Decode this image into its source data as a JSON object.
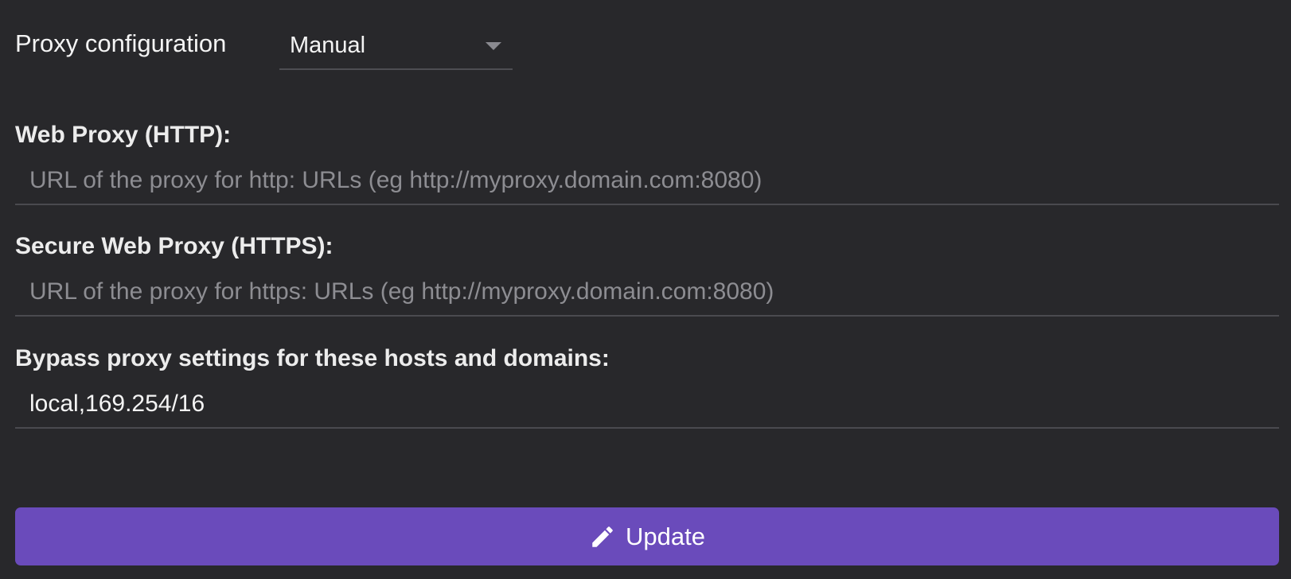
{
  "proxy_config": {
    "label": "Proxy configuration",
    "selected": "Manual"
  },
  "http_proxy": {
    "label": "Web Proxy (HTTP):",
    "value": "",
    "placeholder": "URL of the proxy for http: URLs (eg http://myproxy.domain.com:8080)"
  },
  "https_proxy": {
    "label": "Secure Web Proxy (HTTPS):",
    "value": "",
    "placeholder": "URL of the proxy for https: URLs (eg http://myproxy.domain.com:8080)"
  },
  "bypass": {
    "label": "Bypass proxy settings for these hosts and domains:",
    "value": "local,169.254/16",
    "placeholder": ""
  },
  "update_button": {
    "label": "Update",
    "icon": "pencil-icon",
    "color": "#6a4bbb"
  },
  "colors": {
    "background": "#28282b",
    "divider": "#4a4a4f",
    "placeholder": "#8d8d92"
  }
}
